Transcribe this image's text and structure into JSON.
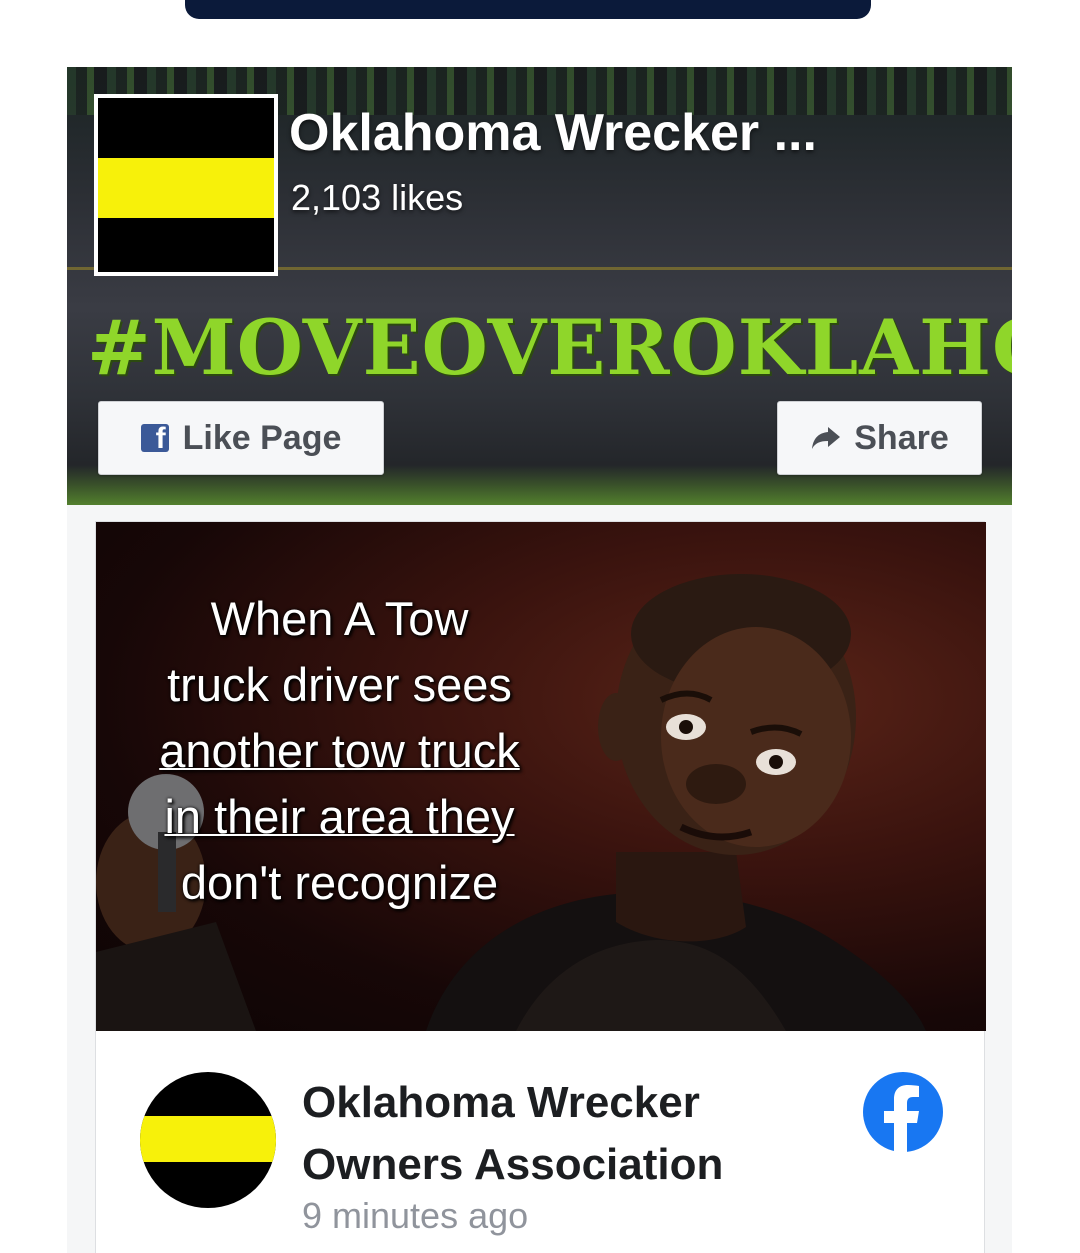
{
  "cover": {
    "page_name": "Oklahoma Wrecker ...",
    "likes": "2,103 likes",
    "hashtag": "#MOVEOVEROKLAHOMA",
    "buttons": {
      "like": "Like Page",
      "share": "Share"
    }
  },
  "post": {
    "image_text": [
      "When A Tow",
      "truck driver sees",
      "another tow truck",
      "in their area they",
      "don't recognize"
    ],
    "author_line1": "Oklahoma Wrecker",
    "author_line2": "Owners Association",
    "time": "9 minutes ago"
  },
  "colors": {
    "facebook_blue": "#1877f2",
    "stripe_yellow": "#f7f10a",
    "hashtag_green": "#8fd62a",
    "top_bar": "#0b1a3a"
  },
  "icons": [
    "facebook-f-icon",
    "share-arrow-icon",
    "facebook-logo-icon"
  ]
}
